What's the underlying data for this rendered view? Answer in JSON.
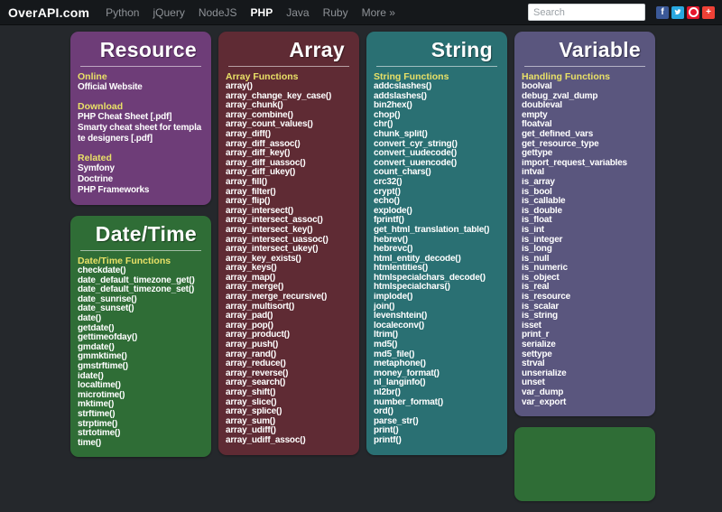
{
  "topbar": {
    "logo": "OverAPI.com",
    "nav": [
      {
        "label": "Python",
        "active": false
      },
      {
        "label": "jQuery",
        "active": false
      },
      {
        "label": "NodeJS",
        "active": false
      },
      {
        "label": "PHP",
        "active": true
      },
      {
        "label": "Java",
        "active": false
      },
      {
        "label": "Ruby",
        "active": false
      },
      {
        "label": "More »",
        "active": false
      }
    ],
    "search_placeholder": "Search",
    "social": [
      {
        "name": "facebook",
        "glyph": "f",
        "color": "#3b5998"
      },
      {
        "name": "twitter",
        "glyph": "bird",
        "color": "#29a8e0"
      },
      {
        "name": "weibo",
        "glyph": "eye",
        "color": "#e6162d"
      },
      {
        "name": "share-plus",
        "glyph": "+",
        "color": "#ef4136"
      }
    ]
  },
  "panels": [
    {
      "id": "resource",
      "title": "Resource",
      "color": "#6e3d78",
      "sections": [
        {
          "header": "Online",
          "links": [
            "Official Website"
          ]
        },
        {
          "header": "Download",
          "links": [
            "PHP Cheat Sheet [.pdf]",
            "Smarty cheat sheet for template designers [.pdf]"
          ]
        },
        {
          "header": "Related",
          "links": [
            "Symfony",
            "Doctrine",
            "PHP Frameworks"
          ]
        }
      ]
    },
    {
      "id": "datetime",
      "title": "Date/Time",
      "color": "#2f6d36",
      "sections": [
        {
          "header": "Date/Time Functions",
          "links": [
            "checkdate()",
            "date_default_timezone_get()",
            "date_default_timezone_set()",
            "date_sunrise()",
            "date_sunset()",
            "date()",
            "getdate()",
            "gettimeofday()",
            "gmdate()",
            "gmmktime()",
            "gmstrftime()",
            "idate()",
            "localtime()",
            "microtime()",
            "mktime()",
            "strftime()",
            "strptime()",
            "strtotime()",
            "time()"
          ]
        }
      ]
    },
    {
      "id": "array",
      "title": "Array",
      "color": "#5f2b34",
      "sections": [
        {
          "header": "Array Functions",
          "links": [
            "array()",
            "array_change_key_case()",
            "array_chunk()",
            "array_combine()",
            "array_count_values()",
            "array_diff()",
            "array_diff_assoc()",
            "array_diff_key()",
            "array_diff_uassoc()",
            "array_diff_ukey()",
            "array_fill()",
            "array_filter()",
            "array_flip()",
            "array_intersect()",
            "array_intersect_assoc()",
            "array_intersect_key()",
            "array_intersect_uassoc()",
            "array_intersect_ukey()",
            "array_key_exists()",
            "array_keys()",
            "array_map()",
            "array_merge()",
            "array_merge_recursive()",
            "array_multisort()",
            "array_pad()",
            "array_pop()",
            "array_product()",
            "array_push()",
            "array_rand()",
            "array_reduce()",
            "array_reverse()",
            "array_search()",
            "array_shift()",
            "array_slice()",
            "array_splice()",
            "array_sum()",
            "array_udiff()",
            "array_udiff_assoc()"
          ]
        }
      ]
    },
    {
      "id": "string",
      "title": "String",
      "color": "#2a7073",
      "sections": [
        {
          "header": "String Functions",
          "links": [
            "addcslashes()",
            "addslashes()",
            "bin2hex()",
            "chop()",
            "chr()",
            "chunk_split()",
            "convert_cyr_string()",
            "convert_uudecode()",
            "convert_uuencode()",
            "count_chars()",
            "crc32()",
            "crypt()",
            "echo()",
            "explode()",
            "fprintf()",
            "get_html_translation_table()",
            "hebrev()",
            "hebrevc()",
            "html_entity_decode()",
            "htmlentities()",
            "htmlspecialchars_decode()",
            "htmlspecialchars()",
            "implode()",
            "join()",
            "levenshtein()",
            "localeconv()",
            "ltrim()",
            "md5()",
            "md5_file()",
            "metaphone()",
            "money_format()",
            "nl_langinfo()",
            "nl2br()",
            "number_format()",
            "ord()",
            "parse_str()",
            "print()",
            "printf()"
          ]
        }
      ]
    },
    {
      "id": "variable",
      "title": "Variable",
      "color": "#5a567e",
      "sections": [
        {
          "header": "Handling Functions",
          "links": [
            "boolval",
            "debug_zval_dump",
            "doubleval",
            "empty",
            "floatval",
            "get_defined_vars",
            "get_resource_type",
            "gettype",
            "import_request_variables",
            "intval",
            "is_array",
            "is_bool",
            "is_callable",
            "is_double",
            "is_float",
            "is_int",
            "is_integer",
            "is_long",
            "is_null",
            "is_numeric",
            "is_object",
            "is_real",
            "is_resource",
            "is_scalar",
            "is_string",
            "isset",
            "print_r",
            "serialize",
            "settype",
            "strval",
            "unserialize",
            "unset",
            "var_dump",
            "var_export"
          ]
        }
      ]
    },
    {
      "id": "next",
      "title": "",
      "color": "#2f6d36",
      "sections": []
    }
  ]
}
